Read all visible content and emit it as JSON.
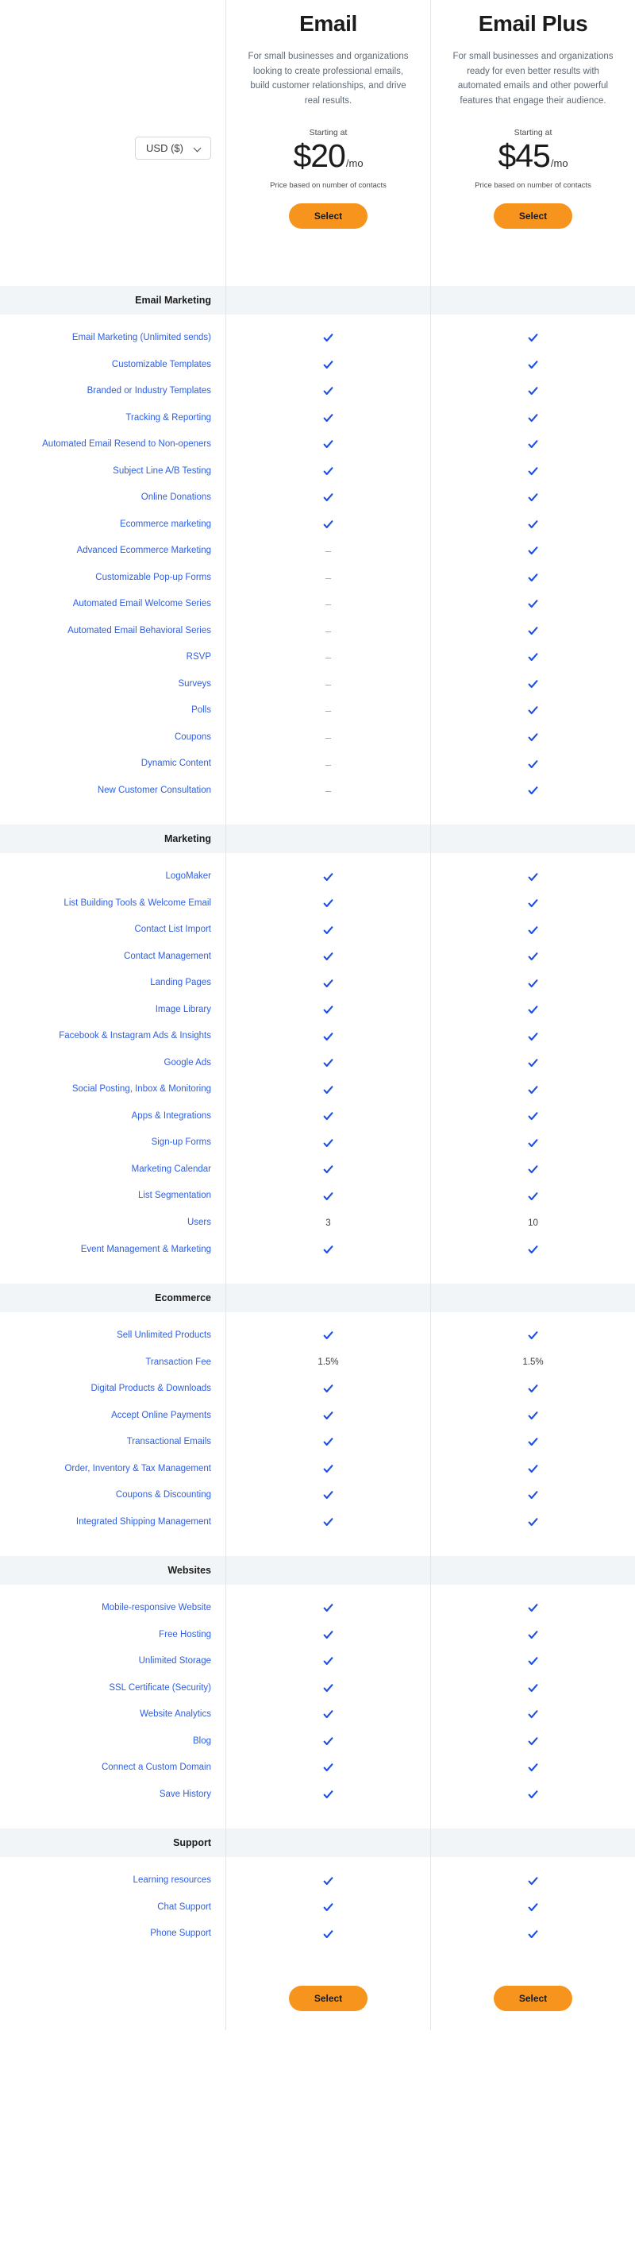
{
  "currency": {
    "label": "USD ($)",
    "chevron_icon": "chevron-down-icon"
  },
  "plans": [
    {
      "name": "Email",
      "description": "For small businesses and organizations looking to create professional emails, build customer relationships, and drive real results.",
      "starting_at": "Starting at",
      "price": "$20",
      "period": "/mo",
      "price_note": "Price based on number of contacts",
      "select_label": "Select"
    },
    {
      "name": "Email Plus",
      "description": "For small businesses and organizations ready for even better results with automated emails and other powerful features that engage their audience.",
      "starting_at": "Starting at",
      "price": "$45",
      "period": "/mo",
      "price_note": "Price based on number of contacts",
      "select_label": "Select"
    }
  ],
  "footer": {
    "select_label_email": "Select",
    "select_label_email_plus": "Select"
  },
  "colors": {
    "accent_orange": "#f7941d",
    "link_blue": "#2f5fe0",
    "check_blue": "#1f4fe0",
    "section_bg": "#f2f5f7",
    "divider": "#e3e6e8",
    "dash_gray": "#9aa2ab"
  },
  "sections": [
    {
      "title": "Email Marketing",
      "rows": [
        {
          "label": "Email Marketing (Unlimited sends)",
          "email": "check",
          "email_plus": "check"
        },
        {
          "label": "Customizable Templates",
          "email": "check",
          "email_plus": "check"
        },
        {
          "label": "Branded or Industry Templates",
          "email": "check",
          "email_plus": "check"
        },
        {
          "label": "Tracking & Reporting",
          "email": "check",
          "email_plus": "check"
        },
        {
          "label": "Automated Email Resend to Non-openers",
          "email": "check",
          "email_plus": "check"
        },
        {
          "label": "Subject Line A/B Testing",
          "email": "check",
          "email_plus": "check"
        },
        {
          "label": "Online Donations",
          "email": "check",
          "email_plus": "check"
        },
        {
          "label": "Ecommerce marketing",
          "email": "check",
          "email_plus": "check"
        },
        {
          "label": "Advanced Ecommerce Marketing",
          "email": "dash",
          "email_plus": "check"
        },
        {
          "label": "Customizable Pop-up Forms",
          "email": "dash",
          "email_plus": "check"
        },
        {
          "label": "Automated Email Welcome Series",
          "email": "dash",
          "email_plus": "check"
        },
        {
          "label": "Automated Email Behavioral Series",
          "email": "dash",
          "email_plus": "check"
        },
        {
          "label": "RSVP",
          "email": "dash",
          "email_plus": "check"
        },
        {
          "label": "Surveys",
          "email": "dash",
          "email_plus": "check"
        },
        {
          "label": "Polls",
          "email": "dash",
          "email_plus": "check"
        },
        {
          "label": "Coupons",
          "email": "dash",
          "email_plus": "check"
        },
        {
          "label": "Dynamic Content",
          "email": "dash",
          "email_plus": "check"
        },
        {
          "label": "New Customer Consultation",
          "email": "dash",
          "email_plus": "check"
        }
      ]
    },
    {
      "title": "Marketing",
      "rows": [
        {
          "label": "LogoMaker",
          "email": "check",
          "email_plus": "check"
        },
        {
          "label": "List Building Tools & Welcome Email",
          "email": "check",
          "email_plus": "check"
        },
        {
          "label": "Contact List Import",
          "email": "check",
          "email_plus": "check"
        },
        {
          "label": "Contact Management",
          "email": "check",
          "email_plus": "check"
        },
        {
          "label": "Landing Pages",
          "email": "check",
          "email_plus": "check"
        },
        {
          "label": "Image Library",
          "email": "check",
          "email_plus": "check"
        },
        {
          "label": "Facebook & Instagram Ads & Insights",
          "email": "check",
          "email_plus": "check"
        },
        {
          "label": "Google Ads",
          "email": "check",
          "email_plus": "check"
        },
        {
          "label": "Social Posting, Inbox & Monitoring",
          "email": "check",
          "email_plus": "check"
        },
        {
          "label": "Apps & Integrations",
          "email": "check",
          "email_plus": "check"
        },
        {
          "label": "Sign-up Forms",
          "email": "check",
          "email_plus": "check"
        },
        {
          "label": "Marketing Calendar",
          "email": "check",
          "email_plus": "check"
        },
        {
          "label": "List Segmentation",
          "email": "check",
          "email_plus": "check"
        },
        {
          "label": "Users",
          "email": "3",
          "email_plus": "10"
        },
        {
          "label": "Event Management & Marketing",
          "email": "check",
          "email_plus": "check"
        }
      ]
    },
    {
      "title": "Ecommerce",
      "rows": [
        {
          "label": "Sell Unlimited Products",
          "email": "check",
          "email_plus": "check"
        },
        {
          "label": "Transaction Fee",
          "email": "1.5%",
          "email_plus": "1.5%"
        },
        {
          "label": "Digital Products & Downloads",
          "email": "check",
          "email_plus": "check"
        },
        {
          "label": "Accept Online Payments",
          "email": "check",
          "email_plus": "check"
        },
        {
          "label": "Transactional Emails",
          "email": "check",
          "email_plus": "check"
        },
        {
          "label": "Order, Inventory & Tax Management",
          "email": "check",
          "email_plus": "check"
        },
        {
          "label": "Coupons & Discounting",
          "email": "check",
          "email_plus": "check"
        },
        {
          "label": "Integrated Shipping Management",
          "email": "check",
          "email_plus": "check"
        }
      ]
    },
    {
      "title": "Websites",
      "rows": [
        {
          "label": "Mobile-responsive Website",
          "email": "check",
          "email_plus": "check"
        },
        {
          "label": "Free Hosting",
          "email": "check",
          "email_plus": "check"
        },
        {
          "label": "Unlimited Storage",
          "email": "check",
          "email_plus": "check"
        },
        {
          "label": "SSL Certificate (Security)",
          "email": "check",
          "email_plus": "check"
        },
        {
          "label": "Website Analytics",
          "email": "check",
          "email_plus": "check"
        },
        {
          "label": "Blog",
          "email": "check",
          "email_plus": "check"
        },
        {
          "label": "Connect a Custom Domain",
          "email": "check",
          "email_plus": "check"
        },
        {
          "label": "Save History",
          "email": "check",
          "email_plus": "check"
        }
      ]
    },
    {
      "title": "Support",
      "rows": [
        {
          "label": "Learning resources",
          "email": "check",
          "email_plus": "check"
        },
        {
          "label": "Chat Support",
          "email": "check",
          "email_plus": "check"
        },
        {
          "label": "Phone Support",
          "email": "check",
          "email_plus": "check"
        }
      ]
    }
  ]
}
